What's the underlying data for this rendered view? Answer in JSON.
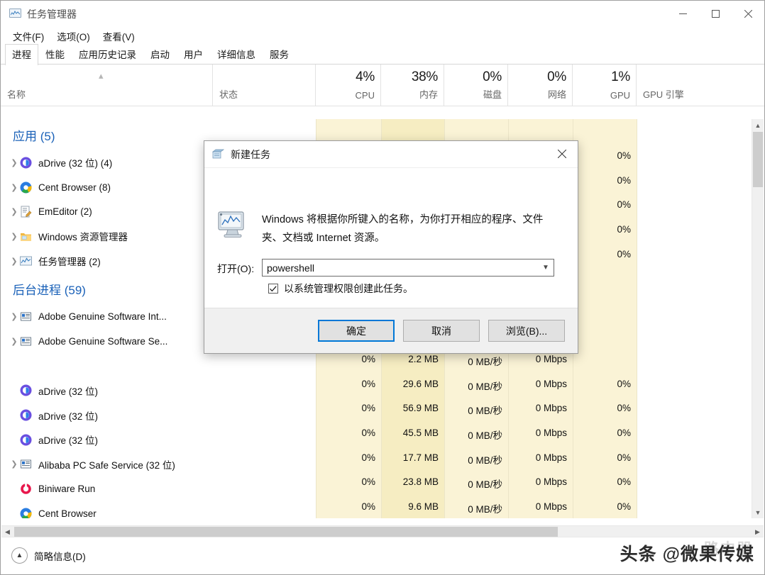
{
  "window": {
    "title": "任务管理器",
    "icon": "taskmanager-icon",
    "controls": {
      "minimize": "–",
      "maximize": "□",
      "close": "✕"
    }
  },
  "menu": [
    {
      "label": "文件(F)"
    },
    {
      "label": "选项(O)"
    },
    {
      "label": "查看(V)"
    }
  ],
  "tabs": [
    {
      "label": "进程",
      "active": true
    },
    {
      "label": "性能",
      "active": false
    },
    {
      "label": "应用历史记录",
      "active": false
    },
    {
      "label": "启动",
      "active": false
    },
    {
      "label": "用户",
      "active": false
    },
    {
      "label": "详细信息",
      "active": false
    },
    {
      "label": "服务",
      "active": false
    }
  ],
  "columns": [
    {
      "key": "name",
      "label": "名称",
      "pct": "",
      "sort": "asc"
    },
    {
      "key": "status",
      "label": "状态",
      "pct": ""
    },
    {
      "key": "cpu",
      "label": "CPU",
      "pct": "4%"
    },
    {
      "key": "mem",
      "label": "内存",
      "pct": "38%"
    },
    {
      "key": "disk",
      "label": "磁盘",
      "pct": "0%"
    },
    {
      "key": "net",
      "label": "网络",
      "pct": "0%"
    },
    {
      "key": "gpu",
      "label": "GPU",
      "pct": "1%"
    },
    {
      "key": "gpueng",
      "label": "GPU 引擎",
      "pct": ""
    }
  ],
  "groups": [
    {
      "title": "应用 (5)",
      "rows": [
        {
          "name": "aDrive (32 位) (4)",
          "icon": "adrive-icon",
          "expandable": true,
          "cpu": "",
          "mem": "",
          "disk": "",
          "net": "",
          "gpu": "0%"
        },
        {
          "name": "Cent Browser (8)",
          "icon": "cent-icon",
          "expandable": true,
          "cpu": "",
          "mem": "",
          "disk": "",
          "net": "",
          "gpu": "0%"
        },
        {
          "name": "EmEditor (2)",
          "icon": "emeditor-icon",
          "expandable": true,
          "cpu": "",
          "mem": "",
          "disk": "",
          "net": "",
          "gpu": "0%"
        },
        {
          "name": "Windows 资源管理器",
          "icon": "folder-icon",
          "expandable": true,
          "cpu": "",
          "mem": "",
          "disk": "",
          "net": "",
          "gpu": "0%"
        },
        {
          "name": "任务管理器 (2)",
          "icon": "taskmanager-icon",
          "expandable": true,
          "cpu": "",
          "mem": "",
          "disk": "",
          "net": "",
          "gpu": "0%"
        }
      ]
    },
    {
      "title": "后台进程 (59)",
      "rows": [
        {
          "name": "Adobe Genuine Software Int...",
          "icon": "generic-app-icon",
          "expandable": true,
          "cpu": "",
          "mem": "",
          "disk": "",
          "net": "",
          "gpu": ""
        },
        {
          "name": "Adobe Genuine Software Se...",
          "icon": "generic-app-icon",
          "expandable": true,
          "cpu": "",
          "mem": "",
          "disk": "",
          "net": "",
          "gpu": ""
        },
        {
          "name": "",
          "icon": "",
          "expandable": false,
          "cpu": "0%",
          "mem": "2.2 MB",
          "disk": "0 MB/秒",
          "net": "0 Mbps",
          "gpu": ""
        },
        {
          "name": "aDrive (32 位)",
          "icon": "adrive-icon",
          "expandable": false,
          "cpu": "0%",
          "mem": "29.6 MB",
          "disk": "0 MB/秒",
          "net": "0 Mbps",
          "gpu": "0%"
        },
        {
          "name": "aDrive (32 位)",
          "icon": "adrive-icon",
          "expandable": false,
          "cpu": "0%",
          "mem": "56.9 MB",
          "disk": "0 MB/秒",
          "net": "0 Mbps",
          "gpu": "0%"
        },
        {
          "name": "aDrive (32 位)",
          "icon": "adrive-icon",
          "expandable": false,
          "cpu": "0%",
          "mem": "45.5 MB",
          "disk": "0 MB/秒",
          "net": "0 Mbps",
          "gpu": "0%"
        },
        {
          "name": "Alibaba PC Safe Service (32 位)",
          "icon": "generic-app-icon",
          "expandable": true,
          "cpu": "0%",
          "mem": "17.7 MB",
          "disk": "0 MB/秒",
          "net": "0 Mbps",
          "gpu": "0%"
        },
        {
          "name": "Biniware Run",
          "icon": "biniware-icon",
          "expandable": false,
          "cpu": "0%",
          "mem": "23.8 MB",
          "disk": "0 MB/秒",
          "net": "0 Mbps",
          "gpu": "0%"
        },
        {
          "name": "Cent Browser",
          "icon": "cent-icon",
          "expandable": false,
          "cpu": "0%",
          "mem": "9.6 MB",
          "disk": "0 MB/秒",
          "net": "0 Mbps",
          "gpu": "0%"
        }
      ]
    }
  ],
  "statusbar": {
    "fewer_details_label": "简略信息(D)",
    "collapse_icon": "chevron-up-icon"
  },
  "dialog": {
    "title": "新建任务",
    "icon": "new-task-icon",
    "close_label": "✕",
    "message": "Windows 将根据你所键入的名称，为你打开相应的程序、文件夹、文档或 Internet 资源。",
    "open_label": "打开(O):",
    "input_value": "powershell",
    "input_placeholder": "",
    "checkbox_label": "以系统管理权限创建此任务。",
    "checkbox_checked": true,
    "buttons": {
      "ok": "确定",
      "cancel": "取消",
      "browse": "浏览(B)..."
    }
  },
  "watermark": {
    "text": "头条 @微果传媒",
    "ghost": "路中器"
  },
  "colors": {
    "group_title": "#1a61b8",
    "accent": "#0078d7",
    "highlight_band": "#f6efc9",
    "highlight_band_light": "#fbf6e2"
  }
}
